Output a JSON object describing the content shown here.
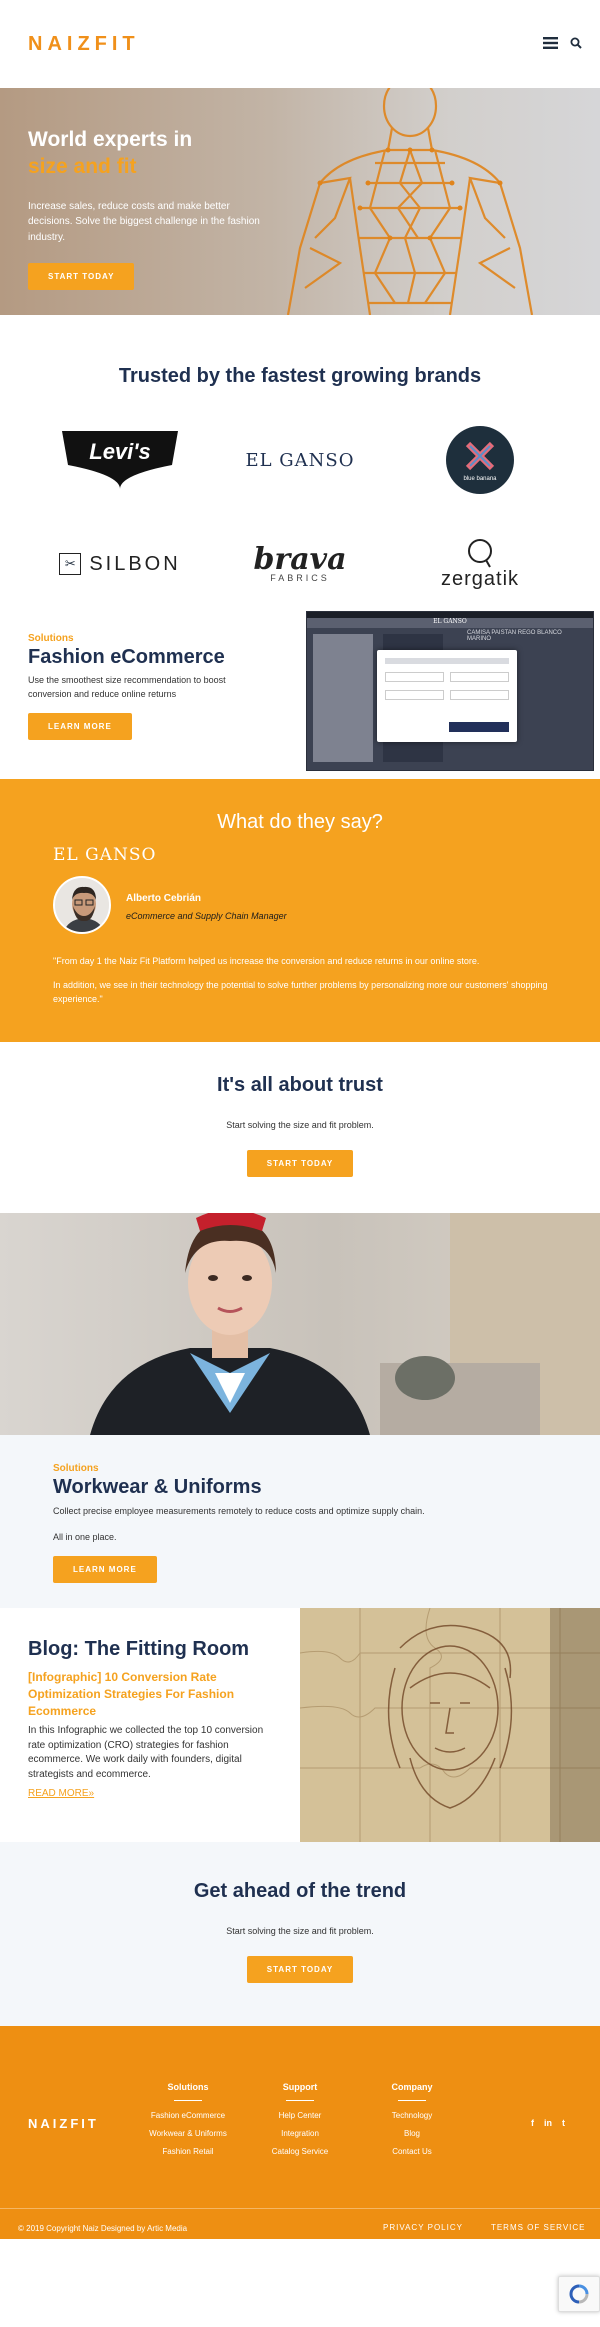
{
  "header": {
    "logo": "NAIZFIT",
    "menu_icon": "hamburger-menu-icon",
    "search_icon": "search-icon"
  },
  "hero": {
    "title_line1": "World experts in",
    "title_line2": "size and fit",
    "subtitle": "Increase sales, reduce costs and make better decisions. Solve the biggest challenge in the fashion industry.",
    "cta": "START TODAY"
  },
  "trusted": {
    "title": "Trusted by the fastest growing brands",
    "brands": [
      {
        "name": "Levi's"
      },
      {
        "name": "EL GANSO"
      },
      {
        "name": "blue banana"
      },
      {
        "name": "SILBON"
      },
      {
        "name": "brava",
        "sub": "FABRICS"
      },
      {
        "name": "zergatik"
      }
    ]
  },
  "fashion": {
    "eyebrow": "Solutions",
    "title": "Fashion eCommerce",
    "description": "Use the smoothest size recommendation to boost conversion and reduce online returns",
    "cta": "LEARN MORE",
    "screenshot_store": "EL GANSO",
    "screenshot_product": "CAMISA PAISTAN REGO BLANCO MARINO"
  },
  "testimonial": {
    "title": "What do they say?",
    "brand": "EL GANSO",
    "name": "Alberto Cebrián",
    "role": "eCommerce and Supply Chain Manager",
    "quote1": "\"From day 1 the Naiz Fit Platform helped us increase the conversion and reduce returns in our online store.",
    "quote2": "In addition, we see in their technology the potential to solve further problems by personalizing more our customers' shopping experience.\""
  },
  "trust": {
    "title": "It's all about trust",
    "subtitle": "Start solving the size and fit problem.",
    "cta": "START TODAY"
  },
  "workwear": {
    "eyebrow": "Solutions",
    "title": "Workwear & Uniforms",
    "description": "Collect precise employee measurements remotely to reduce costs and optimize supply chain.",
    "description2": "All in one place.",
    "cta": "LEARN MORE"
  },
  "blog": {
    "title": "Blog: The Fitting Room",
    "post_title": "[Infographic] 10 Conversion Rate Optimization Strategies For Fashion Ecommerce",
    "post_desc": "In this Infographic we collected the top 10 conversion rate optimization (CRO) strategies for fashion ecommerce. We work daily with founders, digital strategists and ecommerce.",
    "read_more": "READ MORE»"
  },
  "trend": {
    "title": "Get ahead of the trend",
    "subtitle": "Start solving the size and fit problem.",
    "cta": "START TODAY"
  },
  "footer": {
    "logo": "NAIZFIT",
    "columns": [
      {
        "title": "Solutions",
        "items": [
          "Fashion eCommerce",
          "Workwear & Uniforms",
          "Fashion Retail"
        ]
      },
      {
        "title": "Support",
        "items": [
          "Help Center",
          "Integration",
          "Catalog Service"
        ]
      },
      {
        "title": "Company",
        "items": [
          "Technology",
          "Blog",
          "Contact Us"
        ]
      }
    ],
    "social": [
      "f",
      "in",
      "t"
    ],
    "copyright": "© 2019 Copyright Naiz Designed by Artic Media",
    "privacy": "PRIVACY POLICY",
    "terms": "TERMS OF SERVICE"
  },
  "colors": {
    "accent": "#f5a21f",
    "footer": "#ee8f12",
    "heading": "#1f3050"
  }
}
